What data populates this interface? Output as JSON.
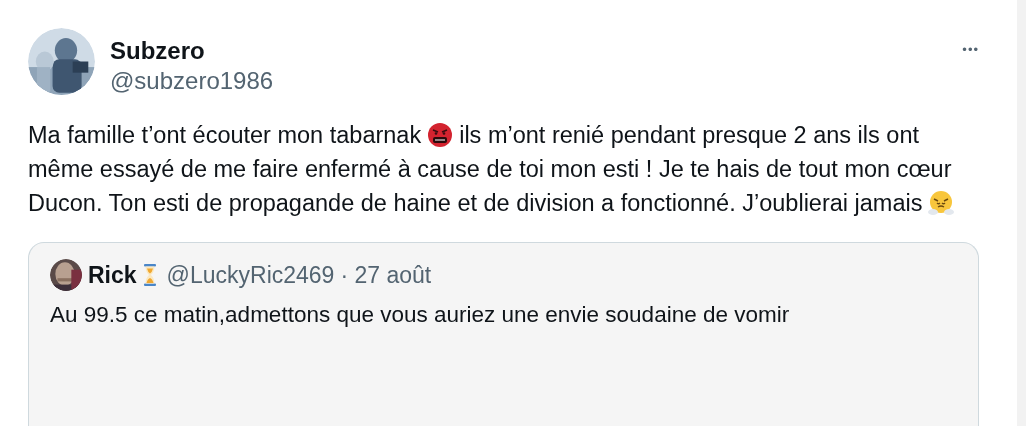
{
  "post": {
    "author": {
      "name": "Subzero",
      "handle": "@subzero1986"
    },
    "menu_label": "•••",
    "body": [
      "Ma famille t’ont écouter mon tabarnak",
      "ils m’ont renié pendant presque 2 ans ils ont même essayé de me faire enfermé à cause de toi mon esti ! Je te hais de tout mon cœur Ducon. Ton esti de propagande de haine et de division a fonctionné. J’oublierai jamais"
    ],
    "quote": {
      "author": {
        "name": "Rick",
        "handle": "@LuckyRic2469"
      },
      "meta": "· 27 août",
      "text": "Au 99.5 ce matin,admettons que vous auriez une envie soudaine de vomir"
    }
  }
}
